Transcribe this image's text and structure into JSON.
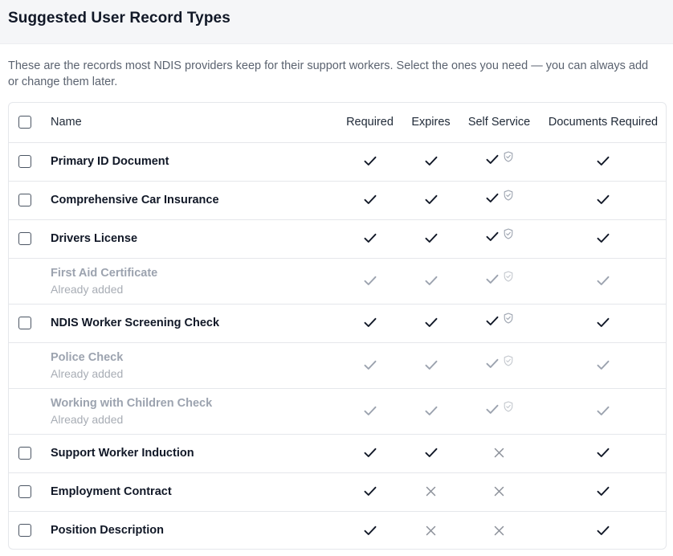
{
  "page": {
    "title": "Suggested User Record Types",
    "intro": "These are the records most NDIS providers keep for their support workers. Select the ones you need — you can always add or change them later."
  },
  "table": {
    "headers": {
      "name": "Name",
      "required": "Required",
      "expires": "Expires",
      "self_service": "Self Service",
      "documents_required": "Documents Required"
    },
    "rows": [
      {
        "name": "Primary ID Document",
        "added": false,
        "sub": "",
        "required": true,
        "expires": true,
        "self_service": true,
        "documents_required": true
      },
      {
        "name": "Comprehensive Car Insurance",
        "added": false,
        "sub": "",
        "required": true,
        "expires": true,
        "self_service": true,
        "documents_required": true
      },
      {
        "name": "Drivers License",
        "added": false,
        "sub": "",
        "required": true,
        "expires": true,
        "self_service": true,
        "documents_required": true
      },
      {
        "name": "First Aid Certificate",
        "added": true,
        "sub": "Already added",
        "required": true,
        "expires": true,
        "self_service": true,
        "documents_required": true
      },
      {
        "name": "NDIS Worker Screening Check",
        "added": false,
        "sub": "",
        "required": true,
        "expires": true,
        "self_service": true,
        "documents_required": true
      },
      {
        "name": "Police Check",
        "added": true,
        "sub": "Already added",
        "required": true,
        "expires": true,
        "self_service": true,
        "documents_required": true
      },
      {
        "name": "Working with Children Check",
        "added": true,
        "sub": "Already added",
        "required": true,
        "expires": true,
        "self_service": true,
        "documents_required": true
      },
      {
        "name": "Support Worker Induction",
        "added": false,
        "sub": "",
        "required": true,
        "expires": true,
        "self_service": false,
        "documents_required": true
      },
      {
        "name": "Employment Contract",
        "added": false,
        "sub": "",
        "required": true,
        "expires": false,
        "self_service": false,
        "documents_required": true
      },
      {
        "name": "Position Description",
        "added": false,
        "sub": "",
        "required": true,
        "expires": false,
        "self_service": false,
        "documents_required": true
      }
    ]
  },
  "icons": {
    "check": "check-icon",
    "cross": "cross-icon",
    "shield": "shield-check-icon"
  },
  "colors": {
    "check_active": "#111827",
    "check_added": "#9ca3af",
    "cross": "#8b9099",
    "shield": "#9ca3af"
  }
}
